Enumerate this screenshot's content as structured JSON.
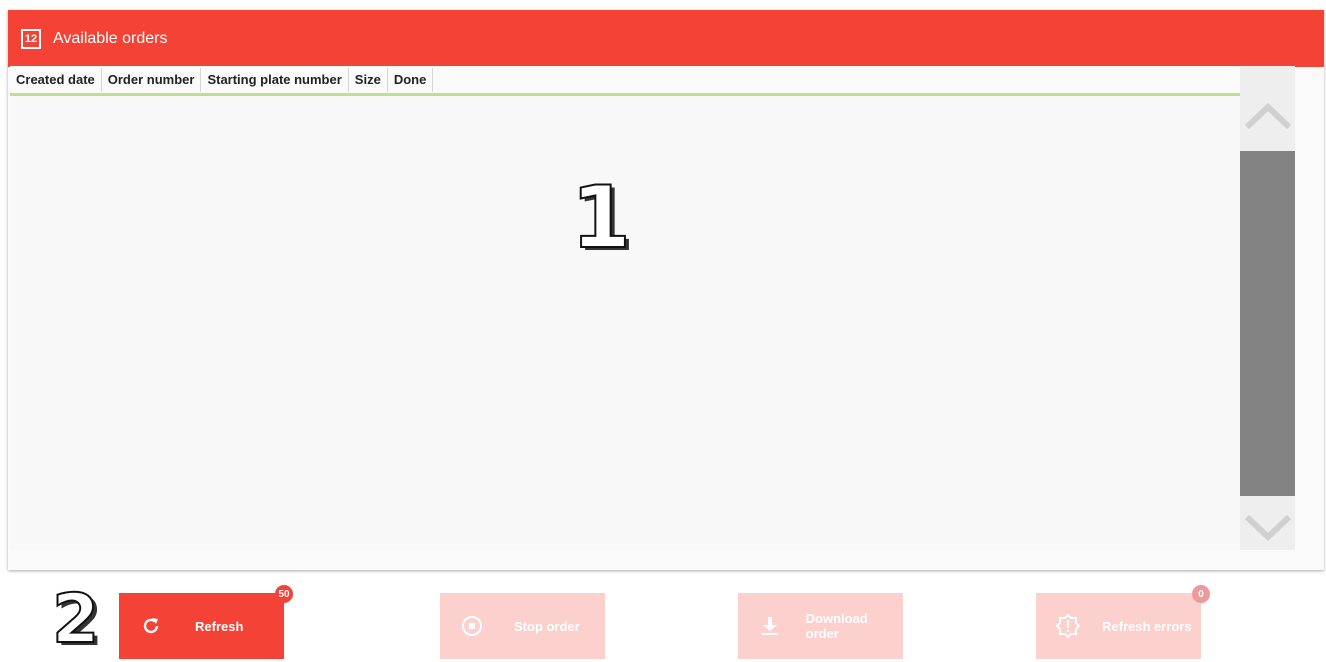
{
  "header": {
    "title": "Available orders",
    "icon": "order-list-icon",
    "color": "#f44336"
  },
  "table": {
    "columns": [
      "Created date",
      "Order number",
      "Starting plate number",
      "Size",
      "Done"
    ],
    "rows": []
  },
  "callouts": {
    "one": "1",
    "two": "2"
  },
  "buttons": {
    "refresh": {
      "label": "Refresh",
      "badge": "50",
      "icon": "refresh-icon"
    },
    "stop": {
      "label": "Stop order",
      "icon": "stop-icon"
    },
    "download": {
      "label": "Download order",
      "icon": "download-icon"
    },
    "refresh_errors": {
      "label": "Refresh errors",
      "badge": "0",
      "icon": "error-gear-icon"
    }
  },
  "colors": {
    "accent": "#f44336",
    "disabled": "#fbd0cd",
    "header_underline": "#b9e38d"
  }
}
